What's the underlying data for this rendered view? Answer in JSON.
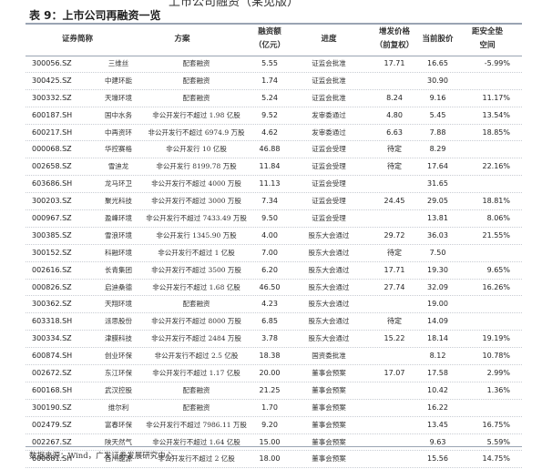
{
  "page": {
    "top_title": "上市公司融资（某见版）",
    "caption": "表 9：上市公司再融资一览",
    "source": "数据来源：Wind，广发证券发展研究中心"
  },
  "table": {
    "headers": {
      "code": "证券简称",
      "plan": "方案",
      "amount_l1": "融资额",
      "amount_l2": "（亿元）",
      "progress": "进度",
      "issue_l1": "增发价格",
      "issue_l2": "（前复权）",
      "current": "当前股价",
      "dist_l1": "距安全垫",
      "dist_l2": "空间"
    },
    "rows": [
      {
        "code": "300056.SZ",
        "name": "三维丝",
        "plan": "配套融资",
        "amount": "5.55",
        "progress": "证监会批准",
        "issue_price": "17.71",
        "current_price": "16.65",
        "distance": "-5.99%"
      },
      {
        "code": "300425.SZ",
        "name": "中建环能",
        "plan": "配套融资",
        "amount": "1.74",
        "progress": "证监会批准",
        "issue_price": "",
        "current_price": "30.90",
        "distance": ""
      },
      {
        "code": "300332.SZ",
        "name": "天壕环境",
        "plan": "配套融资",
        "amount": "5.24",
        "progress": "证监会批准",
        "issue_price": "8.24",
        "current_price": "9.16",
        "distance": "11.17%"
      },
      {
        "code": "600187.SH",
        "name": "国中水务",
        "plan": "非公开发行不超过 1.98 亿股",
        "amount": "9.52",
        "progress": "发审委通过",
        "issue_price": "4.80",
        "current_price": "5.45",
        "distance": "13.54%"
      },
      {
        "code": "600217.SH",
        "name": "中再资环",
        "plan": "非公开发行不超过 6974.9 万股",
        "amount": "4.62",
        "progress": "发审委通过",
        "issue_price": "6.63",
        "current_price": "7.88",
        "distance": "18.85%"
      },
      {
        "code": "000068.SZ",
        "name": "华控赛格",
        "plan": "非公开发行 10 亿股",
        "amount": "46.88",
        "progress": "证监会受理",
        "issue_price": "待定",
        "current_price": "8.29",
        "distance": ""
      },
      {
        "code": "002658.SZ",
        "name": "雪迪龙",
        "plan": "非公开发行 8199.78 万股",
        "amount": "11.84",
        "progress": "证监会受理",
        "issue_price": "待定",
        "current_price": "17.64",
        "distance": "22.16%"
      },
      {
        "code": "603686.SH",
        "name": "龙马环卫",
        "plan": "非公开发行不超过 4000 万股",
        "amount": "11.13",
        "progress": "证监会受理",
        "issue_price": "",
        "current_price": "31.65",
        "distance": ""
      },
      {
        "code": "300203.SZ",
        "name": "聚光科技",
        "plan": "非公开发行不超过 3000 万股",
        "amount": "7.34",
        "progress": "证监会受理",
        "issue_price": "24.45",
        "current_price": "29.05",
        "distance": "18.81%"
      },
      {
        "code": "000967.SZ",
        "name": "盈峰环境",
        "plan": "非公开发行不超过 7433.49 万股",
        "amount": "9.50",
        "progress": "证监会受理",
        "issue_price": "",
        "current_price": "13.81",
        "distance": "8.06%"
      },
      {
        "code": "300385.SZ",
        "name": "雪浪环境",
        "plan": "非公开发行 1345.90 万股",
        "amount": "4.00",
        "progress": "股东大会通过",
        "issue_price": "29.72",
        "current_price": "36.03",
        "distance": "21.55%"
      },
      {
        "code": "300152.SZ",
        "name": "科融环境",
        "plan": "非公开发行不超过 1 亿股",
        "amount": "7.00",
        "progress": "股东大会通过",
        "issue_price": "待定",
        "current_price": "7.50",
        "distance": ""
      },
      {
        "code": "002616.SZ",
        "name": "长青集团",
        "plan": "非公开发行不超过 3500 万股",
        "amount": "6.20",
        "progress": "股东大会通过",
        "issue_price": "17.71",
        "current_price": "19.30",
        "distance": "9.65%"
      },
      {
        "code": "000826.SZ",
        "name": "启迪桑德",
        "plan": "非公开发行不超过 1.68 亿股",
        "amount": "46.50",
        "progress": "股东大会通过",
        "issue_price": "27.74",
        "current_price": "32.09",
        "distance": "16.26%"
      },
      {
        "code": "300362.SZ",
        "name": "天翔环境",
        "plan": "配套融资",
        "amount": "4.23",
        "progress": "股东大会通过",
        "issue_price": "",
        "current_price": "19.00",
        "distance": ""
      },
      {
        "code": "603318.SH",
        "name": "派思股份",
        "plan": "非公开发行不超过 8000 万股",
        "amount": "6.85",
        "progress": "股东大会通过",
        "issue_price": "待定",
        "current_price": "14.09",
        "distance": ""
      },
      {
        "code": "300334.SZ",
        "name": "津膜科技",
        "plan": "非公开发行不超过 2484 万股",
        "amount": "3.78",
        "progress": "股东大会通过",
        "issue_price": "15.22",
        "current_price": "18.14",
        "distance": "19.19%"
      },
      {
        "code": "600874.SH",
        "name": "创业环保",
        "plan": "非公开发行不超过 2.5 亿股",
        "amount": "18.38",
        "progress": "国资委批准",
        "issue_price": "",
        "current_price": "8.12",
        "distance": "10.78%"
      },
      {
        "code": "002672.SZ",
        "name": "东江环保",
        "plan": "非公开发行不超过 1.17 亿股",
        "amount": "20.00",
        "progress": "董事会预案",
        "issue_price": "17.07",
        "current_price": "17.58",
        "distance": "2.99%"
      },
      {
        "code": "600168.SH",
        "name": "武汉控股",
        "plan": "配套融资",
        "amount": "21.25",
        "progress": "董事会预案",
        "issue_price": "",
        "current_price": "10.42",
        "distance": "1.36%"
      },
      {
        "code": "300190.SZ",
        "name": "维尔利",
        "plan": "配套融资",
        "amount": "1.70",
        "progress": "董事会预案",
        "issue_price": "",
        "current_price": "16.22",
        "distance": ""
      },
      {
        "code": "002479.SZ",
        "name": "富春环保",
        "plan": "非公开发行不超过 7986.11 万股",
        "amount": "9.20",
        "progress": "董事会预案",
        "issue_price": "",
        "current_price": "13.45",
        "distance": "16.75%"
      },
      {
        "code": "002267.SZ",
        "name": "陕天然气",
        "plan": "非公开发行不超过 1.64 亿股",
        "amount": "15.00",
        "progress": "董事会预案",
        "issue_price": "",
        "current_price": "9.63",
        "distance": "5.59%"
      },
      {
        "code": "600681.SH",
        "name": "百川能源",
        "plan": "非公开发行不超过 2 亿股",
        "amount": "18.00",
        "progress": "董事会预案",
        "issue_price": "",
        "current_price": "15.56",
        "distance": "14.75%"
      }
    ]
  }
}
